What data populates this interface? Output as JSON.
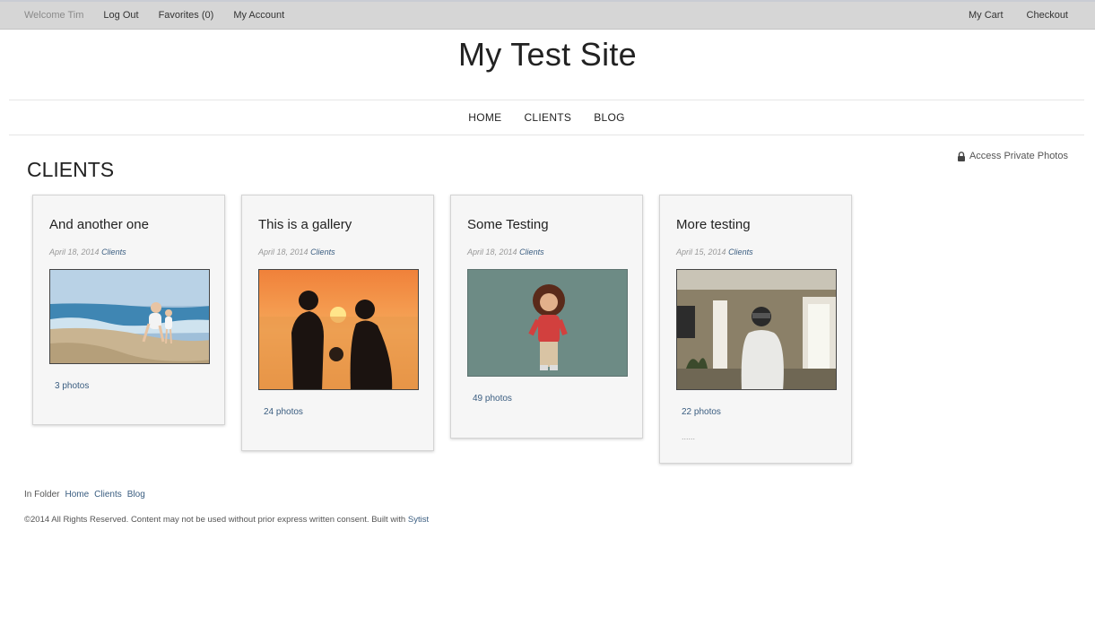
{
  "topbar": {
    "welcome": "Welcome Tim",
    "logout": "Log Out",
    "favorites": "Favorites (0)",
    "account": "My Account",
    "cart": "My Cart",
    "checkout": "Checkout"
  },
  "site": {
    "title": "My Test Site"
  },
  "nav": {
    "home": "HOME",
    "clients": "CLIENTS",
    "blog": "BLOG"
  },
  "page": {
    "heading": "CLIENTS",
    "private_link": "Access Private Photos"
  },
  "galleries": [
    {
      "title": "And another one",
      "date": "April 18, 2014",
      "category": "Clients",
      "count": "3 photos"
    },
    {
      "title": "This is a gallery",
      "date": "April 18, 2014",
      "category": "Clients",
      "count": "24 photos"
    },
    {
      "title": "Some Testing",
      "date": "April 18, 2014",
      "category": "Clients",
      "count": "49 photos"
    },
    {
      "title": "More testing",
      "date": "April 15, 2014",
      "category": "Clients",
      "count": "22 photos",
      "excerpt": "......"
    }
  ],
  "footer": {
    "in_folder": "In Folder",
    "links": [
      "Home",
      "Clients",
      "Blog"
    ],
    "copyright": "©2014 All Rights Reserved. Content may not be used without prior express written consent. Built with",
    "builder": "Sytist"
  },
  "colors": {
    "link": "#3a5d80",
    "topbar": "#d6d6d6"
  }
}
